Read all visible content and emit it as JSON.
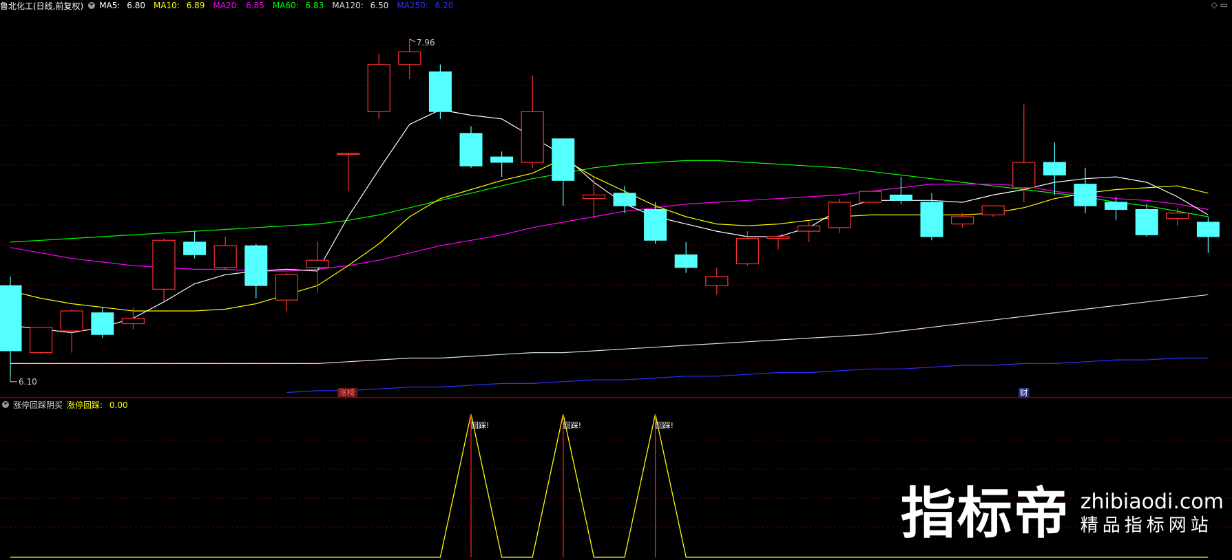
{
  "header": {
    "title": "鲁北化工(日线,前复权)",
    "ma": [
      {
        "label": "MA5:",
        "value": "6.80",
        "color": "#ffffff"
      },
      {
        "label": "MA10:",
        "value": "6.89",
        "color": "#ffff00"
      },
      {
        "label": "MA20:",
        "value": "6.85",
        "color": "#ff00ff"
      },
      {
        "label": "MA60:",
        "value": "6.83",
        "color": "#00ff00"
      },
      {
        "label": "MA120:",
        "value": "6.50",
        "color": "#dddddd"
      },
      {
        "label": "MA250:",
        "value": "6.20",
        "color": "#3030ff"
      }
    ]
  },
  "indicator": {
    "title": "涨停回踩阴买",
    "value_label": "涨停回踩:",
    "value": "0.00",
    "peak_label": "回踩!"
  },
  "markers": {
    "high_label": "7.96",
    "low_label": "6.10",
    "zt_label": "涨榜",
    "cai_label": "财"
  },
  "watermark": {
    "big": "指标帝",
    "url": "zhibiaodi.com",
    "sub": "精品指标网站"
  },
  "chart_data": {
    "type": "candlestick",
    "colors": {
      "up": "#ff3232",
      "down": "#54ffff",
      "ma5": "#ffffff",
      "ma10": "#ffff00",
      "ma20": "#ff00ff",
      "ma60": "#00ff00",
      "ma120": "#dddddd",
      "ma250": "#3030ff"
    },
    "price_range": [
      6.05,
      8.1
    ],
    "candles": [
      {
        "o": 6.6,
        "h": 6.65,
        "l": 6.1,
        "c": 6.24
      },
      {
        "o": 6.23,
        "h": 6.37,
        "l": 6.22,
        "c": 6.37
      },
      {
        "o": 6.35,
        "h": 6.47,
        "l": 6.23,
        "c": 6.46
      },
      {
        "o": 6.45,
        "h": 6.48,
        "l": 6.31,
        "c": 6.33
      },
      {
        "o": 6.39,
        "h": 6.48,
        "l": 6.36,
        "c": 6.42
      },
      {
        "o": 6.58,
        "h": 6.86,
        "l": 6.51,
        "c": 6.85
      },
      {
        "o": 6.84,
        "h": 6.9,
        "l": 6.75,
        "c": 6.77
      },
      {
        "o": 6.7,
        "h": 6.87,
        "l": 6.69,
        "c": 6.82
      },
      {
        "o": 6.82,
        "h": 6.83,
        "l": 6.53,
        "c": 6.6
      },
      {
        "o": 6.52,
        "h": 6.67,
        "l": 6.46,
        "c": 6.66
      },
      {
        "o": 6.7,
        "h": 6.84,
        "l": 6.56,
        "c": 6.74
      },
      {
        "o": 7.33,
        "h": 7.33,
        "l": 7.12,
        "c": 7.33
      },
      {
        "o": 7.56,
        "h": 7.88,
        "l": 7.52,
        "c": 7.82
      },
      {
        "o": 7.82,
        "h": 7.96,
        "l": 7.74,
        "c": 7.89
      },
      {
        "o": 7.78,
        "h": 7.82,
        "l": 7.52,
        "c": 7.56
      },
      {
        "o": 7.44,
        "h": 7.48,
        "l": 7.25,
        "c": 7.26
      },
      {
        "o": 7.31,
        "h": 7.34,
        "l": 7.2,
        "c": 7.28
      },
      {
        "o": 7.28,
        "h": 7.76,
        "l": 7.25,
        "c": 7.56
      },
      {
        "o": 7.41,
        "h": 7.41,
        "l": 7.04,
        "c": 7.18
      },
      {
        "o": 7.08,
        "h": 7.2,
        "l": 6.97,
        "c": 7.1
      },
      {
        "o": 7.11,
        "h": 7.15,
        "l": 7.0,
        "c": 7.04
      },
      {
        "o": 7.02,
        "h": 7.06,
        "l": 6.83,
        "c": 6.85
      },
      {
        "o": 6.77,
        "h": 6.84,
        "l": 6.67,
        "c": 6.7
      },
      {
        "o": 6.6,
        "h": 6.7,
        "l": 6.55,
        "c": 6.65
      },
      {
        "o": 6.72,
        "h": 6.9,
        "l": 6.71,
        "c": 6.86
      },
      {
        "o": 6.86,
        "h": 6.88,
        "l": 6.8,
        "c": 6.87
      },
      {
        "o": 6.9,
        "h": 6.95,
        "l": 6.84,
        "c": 6.93
      },
      {
        "o": 6.92,
        "h": 7.08,
        "l": 6.89,
        "c": 7.06
      },
      {
        "o": 7.06,
        "h": 7.12,
        "l": 7.06,
        "c": 7.12
      },
      {
        "o": 7.1,
        "h": 7.2,
        "l": 7.05,
        "c": 7.07
      },
      {
        "o": 7.06,
        "h": 7.11,
        "l": 6.85,
        "c": 6.87
      },
      {
        "o": 6.94,
        "h": 7.0,
        "l": 6.92,
        "c": 6.98
      },
      {
        "o": 6.99,
        "h": 7.04,
        "l": 6.98,
        "c": 7.04
      },
      {
        "o": 7.14,
        "h": 7.6,
        "l": 7.06,
        "c": 7.28
      },
      {
        "o": 7.28,
        "h": 7.39,
        "l": 7.1,
        "c": 7.21
      },
      {
        "o": 7.16,
        "h": 7.25,
        "l": 7.0,
        "c": 7.04
      },
      {
        "o": 7.06,
        "h": 7.09,
        "l": 6.96,
        "c": 7.02
      },
      {
        "o": 7.02,
        "h": 7.05,
        "l": 6.87,
        "c": 6.88
      },
      {
        "o": 6.97,
        "h": 7.03,
        "l": 6.93,
        "c": 7.0
      },
      {
        "o": 6.95,
        "h": 6.98,
        "l": 6.78,
        "c": 6.87
      }
    ],
    "ma5": [
      6.38,
      6.36,
      6.34,
      6.37,
      6.42,
      6.51,
      6.61,
      6.66,
      6.68,
      6.69,
      6.68,
      6.98,
      7.24,
      7.49,
      7.57,
      7.54,
      7.52,
      7.42,
      7.32,
      7.17,
      7.05,
      6.98,
      6.94,
      6.9,
      6.87,
      6.87,
      6.92,
      7.02,
      7.07,
      7.07,
      7.07,
      7.06,
      7.1,
      7.13,
      7.17,
      7.19,
      7.2,
      7.17,
      7.09,
      6.99
    ],
    "ma10": [
      6.57,
      6.53,
      6.5,
      6.48,
      6.46,
      6.46,
      6.46,
      6.47,
      6.5,
      6.55,
      6.6,
      6.71,
      6.83,
      6.98,
      7.08,
      7.13,
      7.18,
      7.22,
      7.3,
      7.2,
      7.12,
      7.04,
      6.98,
      6.94,
      6.93,
      6.94,
      6.96,
      6.98,
      6.99,
      6.99,
      6.99,
      6.99,
      7.0,
      7.03,
      7.08,
      7.11,
      7.13,
      7.14,
      7.15,
      7.11
    ],
    "ma20": [
      6.81,
      6.78,
      6.75,
      6.73,
      6.71,
      6.7,
      6.69,
      6.69,
      6.68,
      6.68,
      6.69,
      6.71,
      6.74,
      6.78,
      6.82,
      6.85,
      6.88,
      6.92,
      6.95,
      6.98,
      7.01,
      7.03,
      7.05,
      7.06,
      7.07,
      7.08,
      7.09,
      7.1,
      7.12,
      7.14,
      7.16,
      7.16,
      7.16,
      7.15,
      7.12,
      7.1,
      7.08,
      7.07,
      7.05,
      7.02
    ],
    "ma60": [
      6.84,
      6.85,
      6.86,
      6.87,
      6.88,
      6.89,
      6.9,
      6.91,
      6.92,
      6.93,
      6.94,
      6.96,
      6.99,
      7.03,
      7.07,
      7.11,
      7.15,
      7.19,
      7.22,
      7.25,
      7.27,
      7.28,
      7.29,
      7.29,
      7.28,
      7.27,
      7.26,
      7.25,
      7.23,
      7.21,
      7.19,
      7.17,
      7.15,
      7.13,
      7.11,
      7.09,
      7.06,
      7.04,
      7.01,
      6.98
    ],
    "ma120": [
      6.17,
      6.17,
      6.17,
      6.17,
      6.17,
      6.17,
      6.17,
      6.17,
      6.17,
      6.17,
      6.17,
      6.18,
      6.19,
      6.2,
      6.2,
      6.21,
      6.22,
      6.23,
      6.23,
      6.24,
      6.25,
      6.26,
      6.27,
      6.28,
      6.29,
      6.3,
      6.31,
      6.32,
      6.33,
      6.35,
      6.37,
      6.39,
      6.41,
      6.43,
      6.45,
      6.47,
      6.49,
      6.51,
      6.53,
      6.55
    ],
    "ma250": [
      null,
      null,
      null,
      null,
      null,
      null,
      null,
      null,
      null,
      6.01,
      6.02,
      6.02,
      6.03,
      6.04,
      6.04,
      6.05,
      6.06,
      6.06,
      6.07,
      6.08,
      6.08,
      6.09,
      6.1,
      6.1,
      6.11,
      6.12,
      6.12,
      6.13,
      6.14,
      6.14,
      6.15,
      6.16,
      6.16,
      6.17,
      6.17,
      6.18,
      6.19,
      6.19,
      6.2,
      6.2
    ],
    "indicator": [
      0,
      0,
      0,
      0,
      0,
      0,
      0,
      0,
      0,
      0,
      0,
      0,
      0,
      0,
      0,
      1,
      0,
      0,
      1,
      0,
      0,
      1,
      0,
      0,
      0,
      0,
      0,
      0,
      0,
      0,
      0,
      0,
      0,
      0,
      0,
      0,
      0,
      0,
      0,
      0
    ]
  }
}
